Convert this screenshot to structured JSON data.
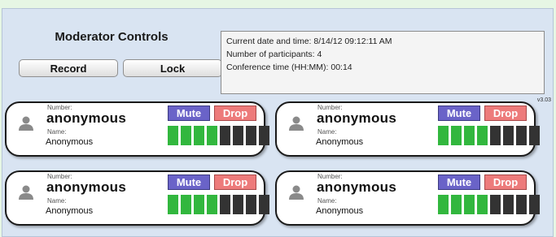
{
  "moderator": {
    "title": "Moderator Controls",
    "record_label": "Record",
    "lock_label": "Lock"
  },
  "info": {
    "line1": "Current date and time:  8/14/12 09:12:11 AM",
    "line2": "Number of participants: 4",
    "line3": "Conference time (HH:MM):  00:14"
  },
  "version": "v3.03",
  "participant_labels": {
    "number": "Number:",
    "name": "Name:",
    "mute": "Mute",
    "drop": "Drop"
  },
  "participants": [
    {
      "number": "anonymous",
      "name": "Anonymous",
      "level": 0.5
    },
    {
      "number": "anonymous",
      "name": "Anonymous",
      "level": 0.5
    },
    {
      "number": "anonymous",
      "name": "Anonymous",
      "level": 0.5
    },
    {
      "number": "anonymous",
      "name": "Anonymous",
      "level": 0.5
    }
  ],
  "colors": {
    "meter_on": "#32b73e",
    "meter_off": "#333333",
    "mute": "#6a63c8",
    "drop": "#ed7b7b"
  },
  "icons": {
    "avatar": "person-silhouette-icon"
  }
}
